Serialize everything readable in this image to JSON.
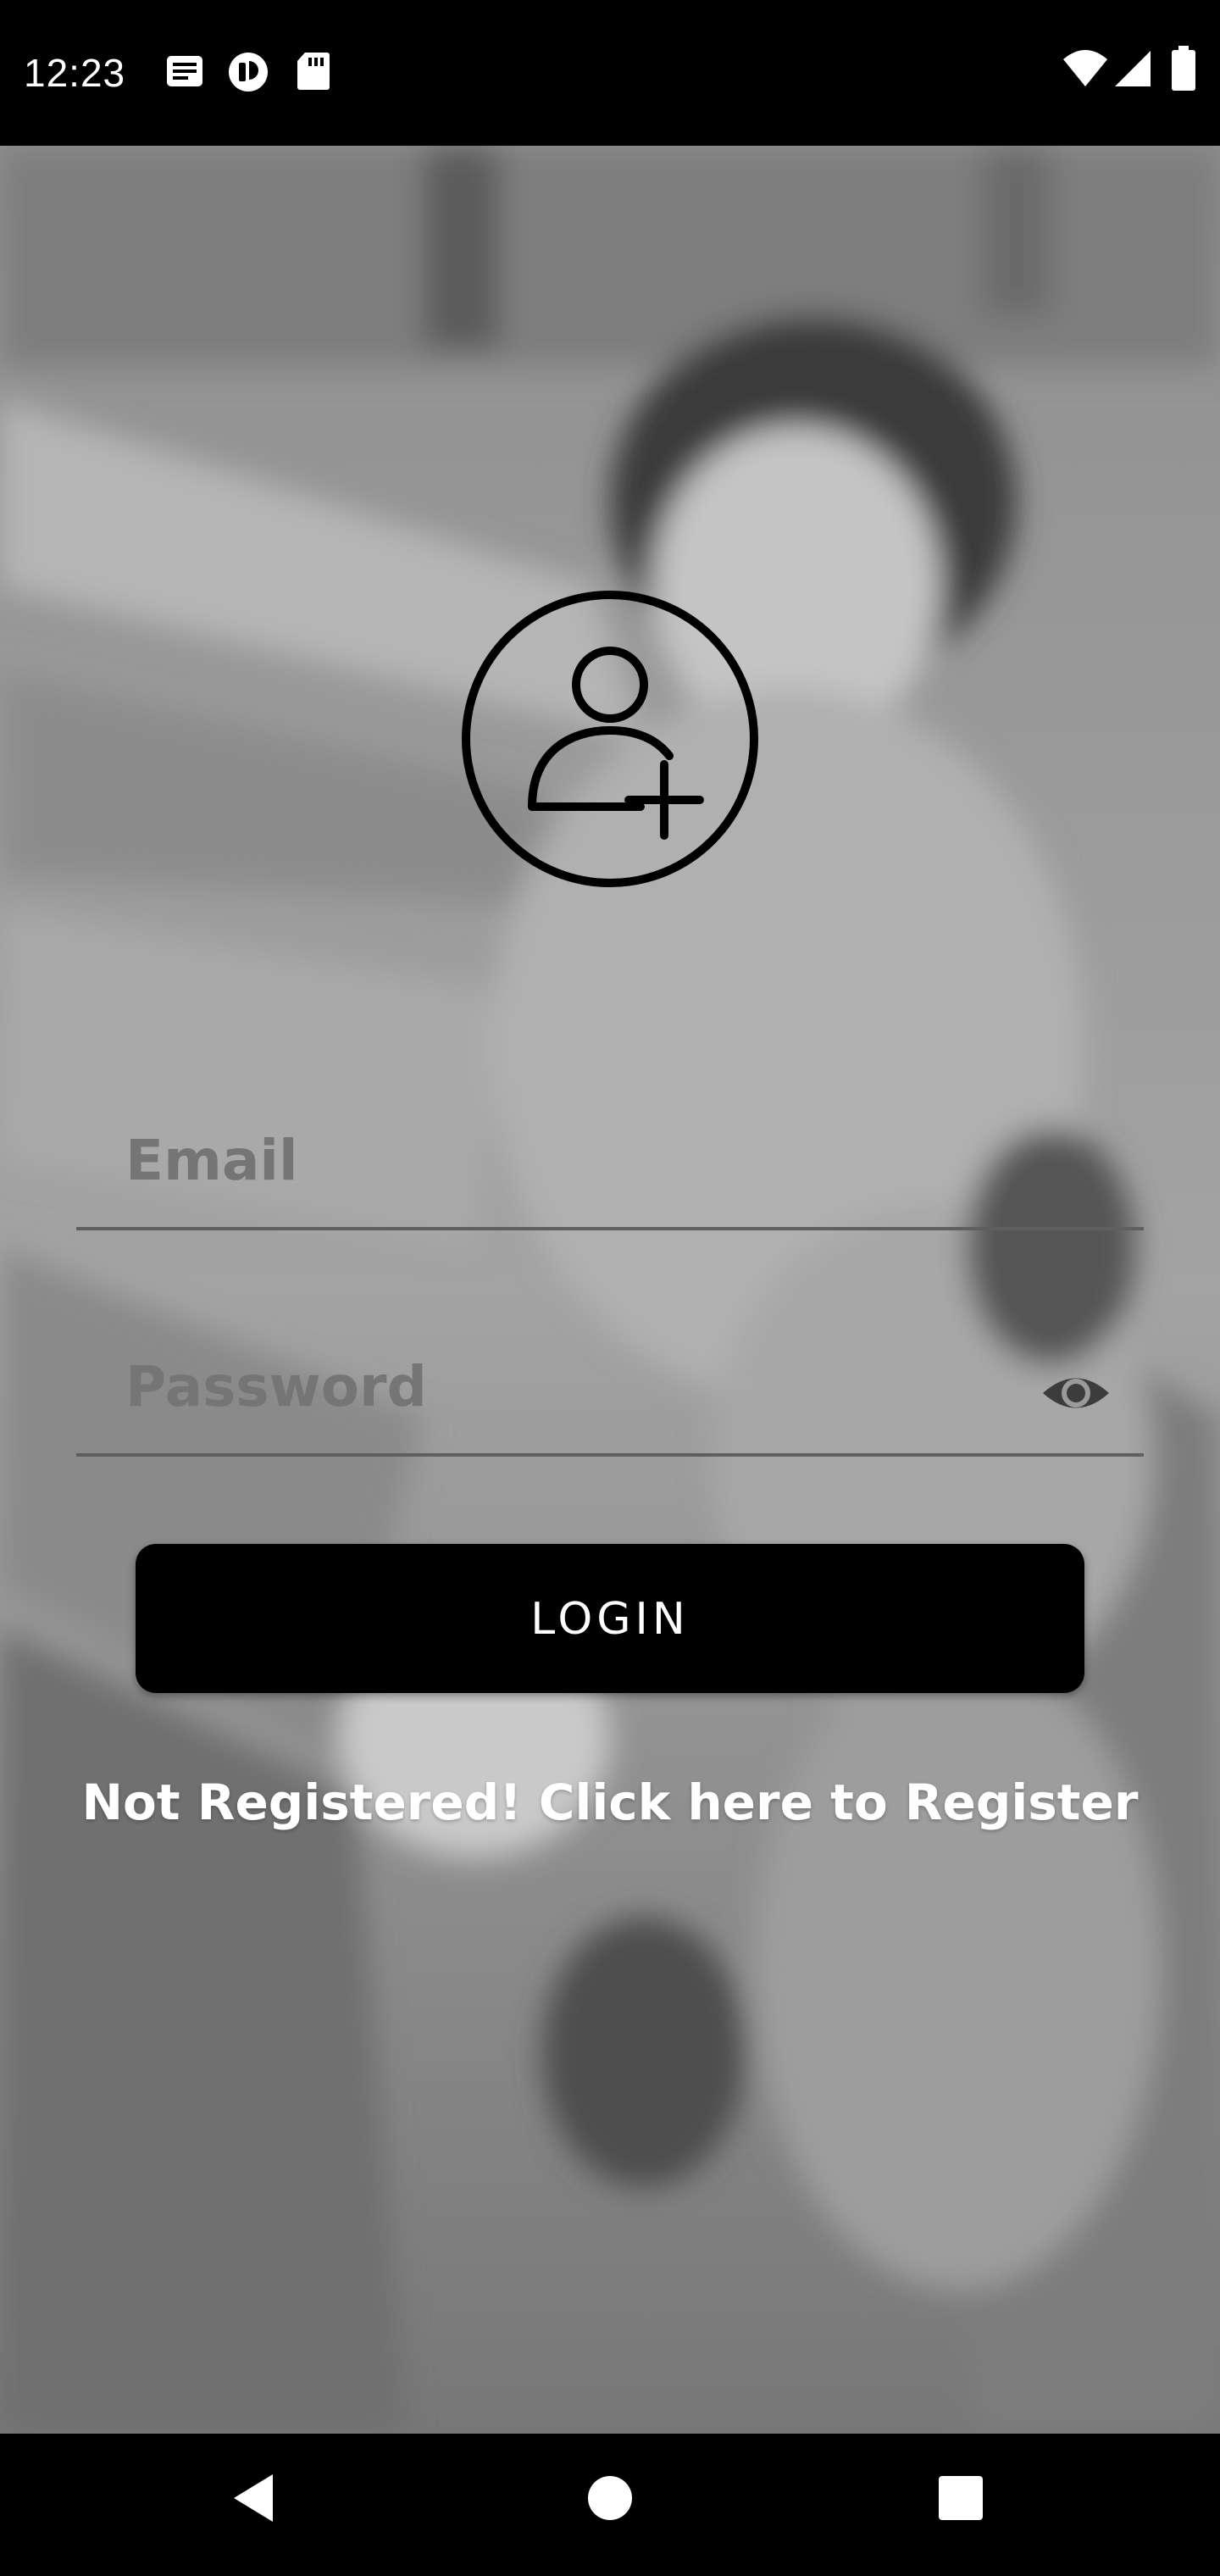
{
  "status_bar": {
    "time": "12:23",
    "left_icons": [
      "news-notification-icon",
      "app-notification-icon",
      "sd-card-icon"
    ],
    "right_icons": [
      "wifi-icon",
      "cellular-signal-icon",
      "battery-icon"
    ]
  },
  "background": {
    "description_icon": "photo-background-icon",
    "tone": "grayscale"
  },
  "avatar": {
    "icon": "add-user-icon"
  },
  "form": {
    "email_placeholder": "Email",
    "email_value": "",
    "password_placeholder": "Password",
    "password_value": "",
    "password_toggle_icon": "eye-icon"
  },
  "login_label": "LOGIN",
  "register_text": "Not Registered! Click here to Register",
  "nav_bar": {
    "back_icon": "back-icon",
    "home_icon": "home-icon",
    "recents_icon": "recents-icon"
  },
  "colors": {
    "button_bg": "#000000",
    "button_text": "#ffffff",
    "link_text": "#ffffff",
    "field_text": "#111111",
    "underline": "#5f5f5f"
  }
}
